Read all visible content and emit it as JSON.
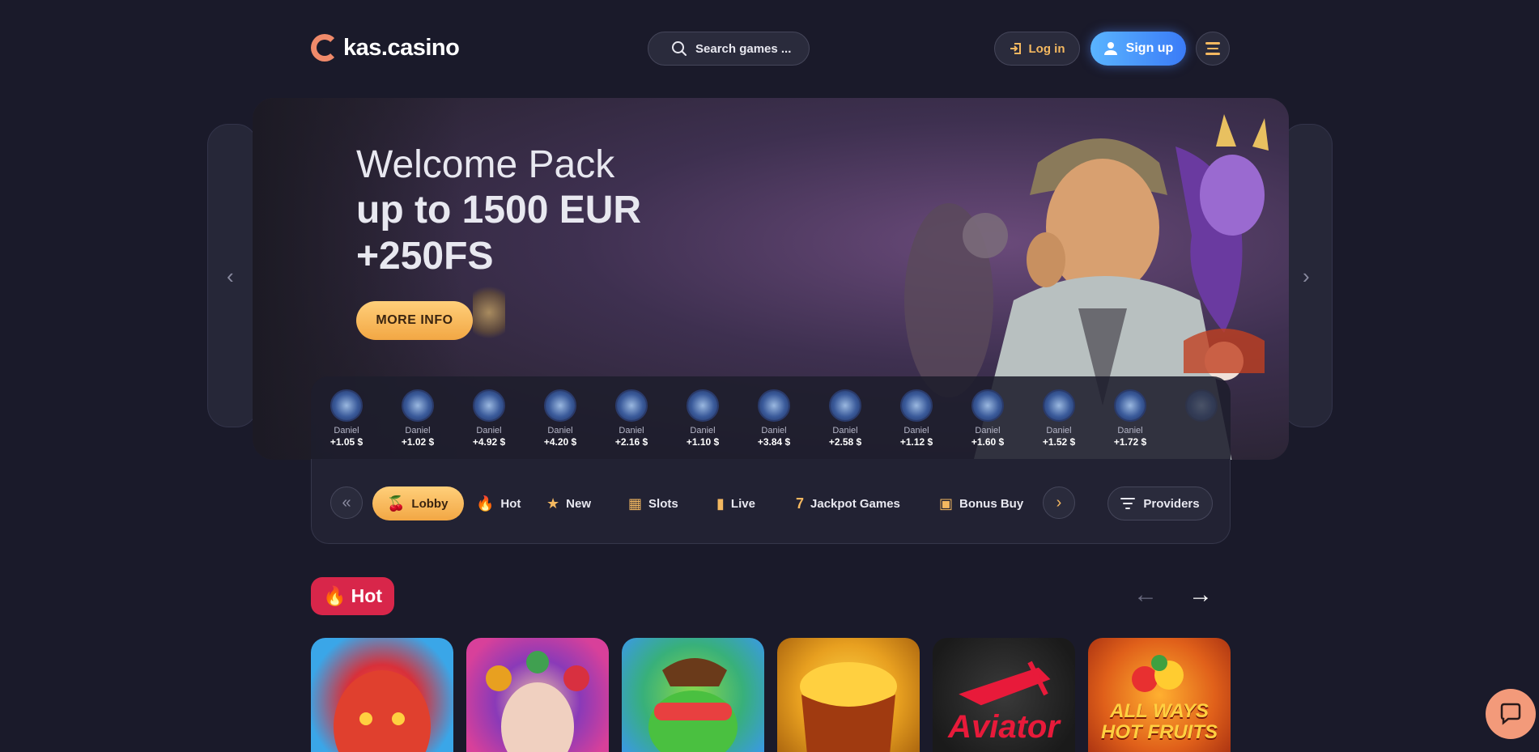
{
  "header": {
    "logo_text": "kas.casino",
    "search_placeholder": "Search games ...",
    "login_label": "Log in",
    "signup_label": "Sign up"
  },
  "banner": {
    "title": "Welcome Pack",
    "subtitle": "up to 1500 EUR\n+250FS",
    "cta_label": "MORE INFO"
  },
  "winners": [
    {
      "name": "Daniel",
      "amount": "+1.05 $"
    },
    {
      "name": "Daniel",
      "amount": "+1.02 $"
    },
    {
      "name": "Daniel",
      "amount": "+4.92 $"
    },
    {
      "name": "Daniel",
      "amount": "+4.20 $"
    },
    {
      "name": "Daniel",
      "amount": "+2.16 $"
    },
    {
      "name": "Daniel",
      "amount": "+1.10 $"
    },
    {
      "name": "Daniel",
      "amount": "+3.84 $"
    },
    {
      "name": "Daniel",
      "amount": "+2.58 $"
    },
    {
      "name": "Daniel",
      "amount": "+1.12 $"
    },
    {
      "name": "Daniel",
      "amount": "+1.60 $"
    },
    {
      "name": "Daniel",
      "amount": "+1.52 $"
    },
    {
      "name": "Daniel",
      "amount": "+1.72 $"
    }
  ],
  "categories": [
    {
      "label": "Lobby",
      "icon": "cherries-icon"
    },
    {
      "label": "Hot",
      "icon": "fire-icon"
    },
    {
      "label": "New",
      "icon": "star-icon"
    },
    {
      "label": "Slots",
      "icon": "slots-icon"
    },
    {
      "label": "Live",
      "icon": "live-icon"
    },
    {
      "label": "Jackpot Games",
      "icon": "seven-icon"
    },
    {
      "label": "Bonus Buy",
      "icon": "gift-icon"
    }
  ],
  "providers_label": "Providers",
  "hot_section": {
    "title": "Hot",
    "games": [
      {
        "label": ""
      },
      {
        "label": ""
      },
      {
        "label": ""
      },
      {
        "label": ""
      },
      {
        "label": "Aviator"
      },
      {
        "label": "ALL WAYS HOT FRUITS"
      }
    ]
  },
  "colors": {
    "background": "#1a1a2a",
    "accent_gold": "#f4b860",
    "signup_blue": "#3a7bf7",
    "hot_red": "#d8264a"
  }
}
